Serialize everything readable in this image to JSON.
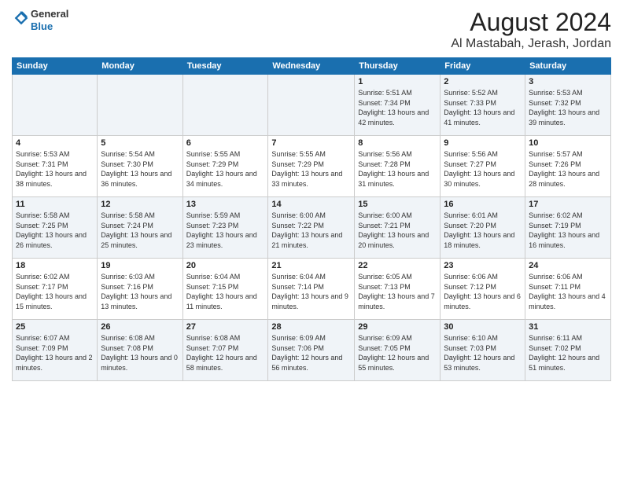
{
  "header": {
    "logo_general": "General",
    "logo_blue": "Blue",
    "month_title": "August 2024",
    "location": "Al Mastabah, Jerash, Jordan"
  },
  "days_of_week": [
    "Sunday",
    "Monday",
    "Tuesday",
    "Wednesday",
    "Thursday",
    "Friday",
    "Saturday"
  ],
  "weeks": [
    [
      {
        "day": "",
        "sunrise": "",
        "sunset": "",
        "daylight": ""
      },
      {
        "day": "",
        "sunrise": "",
        "sunset": "",
        "daylight": ""
      },
      {
        "day": "",
        "sunrise": "",
        "sunset": "",
        "daylight": ""
      },
      {
        "day": "",
        "sunrise": "",
        "sunset": "",
        "daylight": ""
      },
      {
        "day": "1",
        "sunrise": "Sunrise: 5:51 AM",
        "sunset": "Sunset: 7:34 PM",
        "daylight": "Daylight: 13 hours and 42 minutes."
      },
      {
        "day": "2",
        "sunrise": "Sunrise: 5:52 AM",
        "sunset": "Sunset: 7:33 PM",
        "daylight": "Daylight: 13 hours and 41 minutes."
      },
      {
        "day": "3",
        "sunrise": "Sunrise: 5:53 AM",
        "sunset": "Sunset: 7:32 PM",
        "daylight": "Daylight: 13 hours and 39 minutes."
      }
    ],
    [
      {
        "day": "4",
        "sunrise": "Sunrise: 5:53 AM",
        "sunset": "Sunset: 7:31 PM",
        "daylight": "Daylight: 13 hours and 38 minutes."
      },
      {
        "day": "5",
        "sunrise": "Sunrise: 5:54 AM",
        "sunset": "Sunset: 7:30 PM",
        "daylight": "Daylight: 13 hours and 36 minutes."
      },
      {
        "day": "6",
        "sunrise": "Sunrise: 5:55 AM",
        "sunset": "Sunset: 7:29 PM",
        "daylight": "Daylight: 13 hours and 34 minutes."
      },
      {
        "day": "7",
        "sunrise": "Sunrise: 5:55 AM",
        "sunset": "Sunset: 7:29 PM",
        "daylight": "Daylight: 13 hours and 33 minutes."
      },
      {
        "day": "8",
        "sunrise": "Sunrise: 5:56 AM",
        "sunset": "Sunset: 7:28 PM",
        "daylight": "Daylight: 13 hours and 31 minutes."
      },
      {
        "day": "9",
        "sunrise": "Sunrise: 5:56 AM",
        "sunset": "Sunset: 7:27 PM",
        "daylight": "Daylight: 13 hours and 30 minutes."
      },
      {
        "day": "10",
        "sunrise": "Sunrise: 5:57 AM",
        "sunset": "Sunset: 7:26 PM",
        "daylight": "Daylight: 13 hours and 28 minutes."
      }
    ],
    [
      {
        "day": "11",
        "sunrise": "Sunrise: 5:58 AM",
        "sunset": "Sunset: 7:25 PM",
        "daylight": "Daylight: 13 hours and 26 minutes."
      },
      {
        "day": "12",
        "sunrise": "Sunrise: 5:58 AM",
        "sunset": "Sunset: 7:24 PM",
        "daylight": "Daylight: 13 hours and 25 minutes."
      },
      {
        "day": "13",
        "sunrise": "Sunrise: 5:59 AM",
        "sunset": "Sunset: 7:23 PM",
        "daylight": "Daylight: 13 hours and 23 minutes."
      },
      {
        "day": "14",
        "sunrise": "Sunrise: 6:00 AM",
        "sunset": "Sunset: 7:22 PM",
        "daylight": "Daylight: 13 hours and 21 minutes."
      },
      {
        "day": "15",
        "sunrise": "Sunrise: 6:00 AM",
        "sunset": "Sunset: 7:21 PM",
        "daylight": "Daylight: 13 hours and 20 minutes."
      },
      {
        "day": "16",
        "sunrise": "Sunrise: 6:01 AM",
        "sunset": "Sunset: 7:20 PM",
        "daylight": "Daylight: 13 hours and 18 minutes."
      },
      {
        "day": "17",
        "sunrise": "Sunrise: 6:02 AM",
        "sunset": "Sunset: 7:19 PM",
        "daylight": "Daylight: 13 hours and 16 minutes."
      }
    ],
    [
      {
        "day": "18",
        "sunrise": "Sunrise: 6:02 AM",
        "sunset": "Sunset: 7:17 PM",
        "daylight": "Daylight: 13 hours and 15 minutes."
      },
      {
        "day": "19",
        "sunrise": "Sunrise: 6:03 AM",
        "sunset": "Sunset: 7:16 PM",
        "daylight": "Daylight: 13 hours and 13 minutes."
      },
      {
        "day": "20",
        "sunrise": "Sunrise: 6:04 AM",
        "sunset": "Sunset: 7:15 PM",
        "daylight": "Daylight: 13 hours and 11 minutes."
      },
      {
        "day": "21",
        "sunrise": "Sunrise: 6:04 AM",
        "sunset": "Sunset: 7:14 PM",
        "daylight": "Daylight: 13 hours and 9 minutes."
      },
      {
        "day": "22",
        "sunrise": "Sunrise: 6:05 AM",
        "sunset": "Sunset: 7:13 PM",
        "daylight": "Daylight: 13 hours and 7 minutes."
      },
      {
        "day": "23",
        "sunrise": "Sunrise: 6:06 AM",
        "sunset": "Sunset: 7:12 PM",
        "daylight": "Daylight: 13 hours and 6 minutes."
      },
      {
        "day": "24",
        "sunrise": "Sunrise: 6:06 AM",
        "sunset": "Sunset: 7:11 PM",
        "daylight": "Daylight: 13 hours and 4 minutes."
      }
    ],
    [
      {
        "day": "25",
        "sunrise": "Sunrise: 6:07 AM",
        "sunset": "Sunset: 7:09 PM",
        "daylight": "Daylight: 13 hours and 2 minutes."
      },
      {
        "day": "26",
        "sunrise": "Sunrise: 6:08 AM",
        "sunset": "Sunset: 7:08 PM",
        "daylight": "Daylight: 13 hours and 0 minutes."
      },
      {
        "day": "27",
        "sunrise": "Sunrise: 6:08 AM",
        "sunset": "Sunset: 7:07 PM",
        "daylight": "Daylight: 12 hours and 58 minutes."
      },
      {
        "day": "28",
        "sunrise": "Sunrise: 6:09 AM",
        "sunset": "Sunset: 7:06 PM",
        "daylight": "Daylight: 12 hours and 56 minutes."
      },
      {
        "day": "29",
        "sunrise": "Sunrise: 6:09 AM",
        "sunset": "Sunset: 7:05 PM",
        "daylight": "Daylight: 12 hours and 55 minutes."
      },
      {
        "day": "30",
        "sunrise": "Sunrise: 6:10 AM",
        "sunset": "Sunset: 7:03 PM",
        "daylight": "Daylight: 12 hours and 53 minutes."
      },
      {
        "day": "31",
        "sunrise": "Sunrise: 6:11 AM",
        "sunset": "Sunset: 7:02 PM",
        "daylight": "Daylight: 12 hours and 51 minutes."
      }
    ]
  ]
}
